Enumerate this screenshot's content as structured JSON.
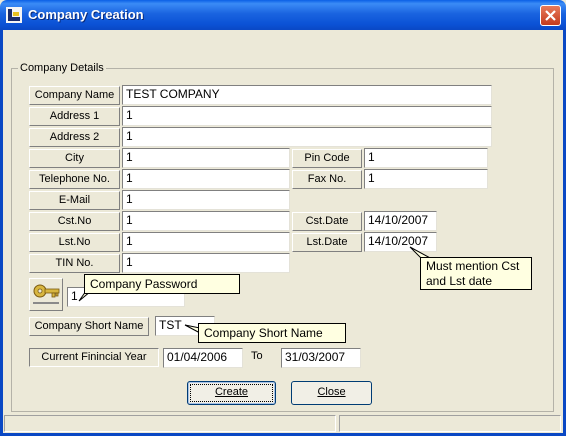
{
  "window": {
    "title": "Company Creation"
  },
  "group": {
    "title": "Company Details"
  },
  "fields": {
    "company_name": {
      "label": "Company Name",
      "value": "TEST COMPANY"
    },
    "address1": {
      "label": "Address 1",
      "value": "1"
    },
    "address2": {
      "label": "Address 2",
      "value": "1"
    },
    "city": {
      "label": "City",
      "value": "1"
    },
    "pin_code": {
      "label": "Pin Code",
      "value": "1"
    },
    "telephone": {
      "label": "Telephone No.",
      "value": "1"
    },
    "fax": {
      "label": "Fax No.",
      "value": "1"
    },
    "email": {
      "label": "E-Mail",
      "value": "1"
    },
    "cst_no": {
      "label": "Cst.No",
      "value": "1"
    },
    "cst_date": {
      "label": "Cst.Date",
      "value": "14/10/2007"
    },
    "lst_no": {
      "label": "Lst.No",
      "value": "1"
    },
    "lst_date": {
      "label": "Lst.Date",
      "value": "14/10/2007"
    },
    "tin_no": {
      "label": "TIN No.",
      "value": "1"
    },
    "password": {
      "value": "1"
    },
    "short_name": {
      "label": "Company Short Name",
      "value": "TST"
    },
    "fin_year": {
      "label": "Current Finincial Year",
      "from": "01/04/2006",
      "to_label": "To",
      "to": "31/03/2007"
    }
  },
  "tooltips": {
    "password": "Company Password",
    "cst_lst": "Must mention Cst and Lst date",
    "short_name": "Company Short Name"
  },
  "buttons": {
    "create": "Create",
    "close": "Close"
  },
  "icons": {
    "app": "app-icon",
    "key": "key-icon",
    "close": "close-icon"
  }
}
